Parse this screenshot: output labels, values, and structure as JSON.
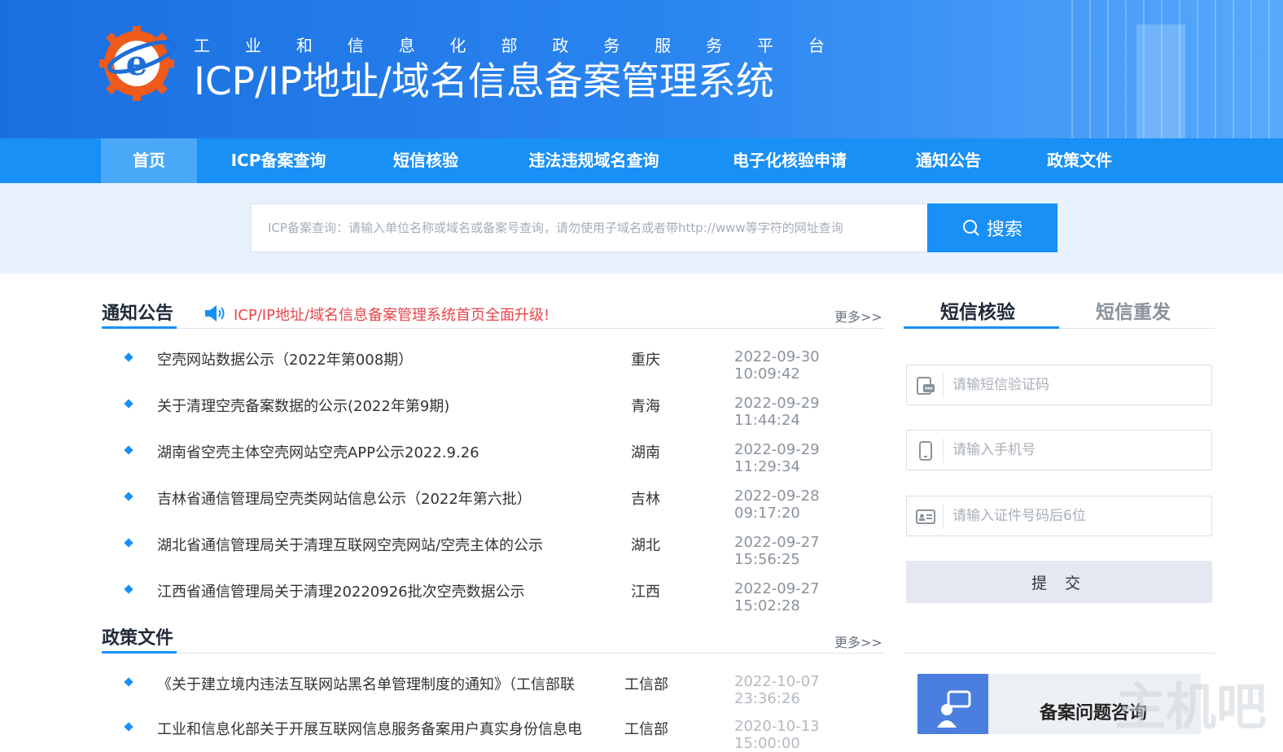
{
  "header": {
    "subtitle_chars": [
      "工",
      "业",
      "和",
      "信",
      "息",
      "化",
      "部",
      "政",
      "务",
      "服",
      "务",
      "平",
      "台"
    ],
    "title": "ICP/IP地址/域名信息备案管理系统"
  },
  "nav": {
    "items": [
      {
        "label": "首页",
        "active": true
      },
      {
        "label": "ICP备案查询"
      },
      {
        "label": "短信核验"
      },
      {
        "label": "违法违规域名查询"
      },
      {
        "label": "电子化核验申请"
      },
      {
        "label": "通知公告"
      },
      {
        "label": "政策文件"
      }
    ]
  },
  "search": {
    "placeholder": "ICP备案查询：请输入单位名称或域名或备案号查询，请勿使用子域名或者带http://www等字符的网址查询",
    "button_label": "搜索"
  },
  "notices": {
    "title": "通知公告",
    "announcement": "ICP/IP地址/域名信息备案管理系统首页全面升级!",
    "more": "更多>>",
    "rows": [
      {
        "title": "空壳网站数据公示（2022年第008期）",
        "region": "重庆",
        "date": "2022-09-30 10:09:42"
      },
      {
        "title": "关于清理空壳备案数据的公示(2022年第9期)",
        "region": "青海",
        "date": "2022-09-29 11:44:24"
      },
      {
        "title": "湖南省空壳主体空壳网站空壳APP公示2022.9.26",
        "region": "湖南",
        "date": "2022-09-29 11:29:34"
      },
      {
        "title": "吉林省通信管理局空壳类网站信息公示（2022年第六批）",
        "region": "吉林",
        "date": "2022-09-28 09:17:20"
      },
      {
        "title": "湖北省通信管理局关于清理互联网空壳网站/空壳主体的公示",
        "region": "湖北",
        "date": "2022-09-27 15:56:25"
      },
      {
        "title": "江西省通信管理局关于清理20220926批次空壳数据公示",
        "region": "江西",
        "date": "2022-09-27 15:02:28"
      }
    ]
  },
  "policies": {
    "title": "政策文件",
    "more": "更多>>",
    "rows": [
      {
        "title": "《关于建立境内违法互联网站黑名单管理制度的通知》（工信部联",
        "region": "工信部",
        "date": "2022-10-07 23:36:26"
      },
      {
        "title": "工业和信息化部关于开展互联网信息服务备案用户真实身份信息电",
        "region": "工信部",
        "date": "2020-10-13 15:00:00"
      }
    ]
  },
  "sms_panel": {
    "tabs": [
      {
        "label": "短信核验",
        "active": true
      },
      {
        "label": "短信重发"
      }
    ],
    "fields": [
      {
        "icon": "sms-icon",
        "placeholder": "请输短信验证码"
      },
      {
        "icon": "phone-icon",
        "placeholder": "请输入手机号"
      },
      {
        "icon": "id-card-icon",
        "placeholder": "请输入证件号码后6位"
      }
    ],
    "submit_label": "提 交"
  },
  "consult": {
    "label": "备案问题咨询"
  },
  "watermark": "主机吧",
  "colors": {
    "primary": "#1890f5",
    "nav_active": "#49a9f8",
    "announcement": "#e8454b",
    "logo_orange": "#f05a1a"
  }
}
